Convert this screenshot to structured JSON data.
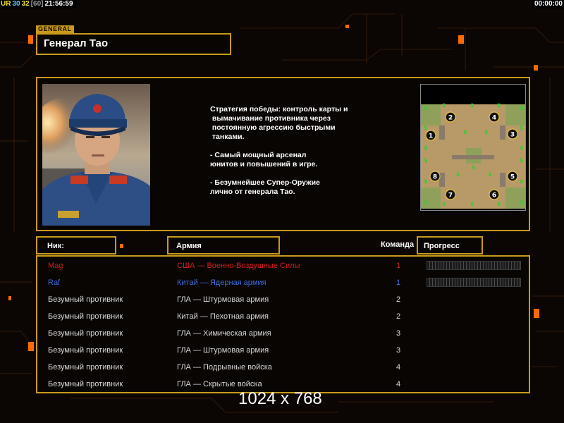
{
  "hud": {
    "left": [
      {
        "text": "UR",
        "color": "#f0e020"
      },
      {
        "text": "30",
        "color": "#58c8ff"
      },
      {
        "text": "32",
        "color": "#f0e020"
      },
      {
        "text": "[60]",
        "color": "#9a9a9a"
      },
      {
        "text": "21:56:59",
        "color": "#ffffff"
      }
    ],
    "right": "00:00:00"
  },
  "general": {
    "tag": "GENERAL",
    "title": "Генерал Тао",
    "strategy": "Стратегия победы: контроль карты и\n вымачивание противника через\n постоянную агрессию быстрыми\n танками.\n\n- Самый мощный арсенал\nюнитов и повышений в игре.\n\n- Безумнейшее Супер-Оружие\nлично от генерала Тао."
  },
  "minimap": {
    "start_positions": [
      "1",
      "2",
      "3",
      "4",
      "5",
      "6",
      "7",
      "8"
    ]
  },
  "table": {
    "headers": {
      "nick": "Ник:",
      "army": "Армия",
      "team": "Команда",
      "progress": "Прогресс"
    },
    "rows": [
      {
        "nick": "Mag",
        "army": "США — Военно-Воздушные Силы",
        "team": "1",
        "color": "#d02020",
        "show_progress": true
      },
      {
        "nick": "Raf",
        "army": "Китай — Ядерная армия",
        "team": "1",
        "color": "#3a6fe0",
        "show_progress": true
      },
      {
        "nick": "Безумный противник",
        "army": "ГЛА — Штурмовая армия",
        "team": "2",
        "color": "#d8d8d8",
        "show_progress": false
      },
      {
        "nick": "Безумный противник",
        "army": "Китай — Пехотная армия",
        "team": "2",
        "color": "#d8d8d8",
        "show_progress": false
      },
      {
        "nick": "Безумный противник",
        "army": "ГЛА — Химическая армия",
        "team": "3",
        "color": "#d8d8d8",
        "show_progress": false
      },
      {
        "nick": "Безумный противник",
        "army": "ГЛА — Штурмовая армия",
        "team": "3",
        "color": "#d8d8d8",
        "show_progress": false
      },
      {
        "nick": "Безумный противник",
        "army": "ГЛА — Подрывные войска",
        "team": "4",
        "color": "#d8d8d8",
        "show_progress": false
      },
      {
        "nick": "Безумный противник",
        "army": "ГЛА — Скрытые войска",
        "team": "4",
        "color": "#d8d8d8",
        "show_progress": false
      }
    ]
  },
  "resolution_label": "1024 x 768",
  "colors": {
    "frame_gold": "#c99a1a",
    "accent_orange": "#ff6a00"
  }
}
